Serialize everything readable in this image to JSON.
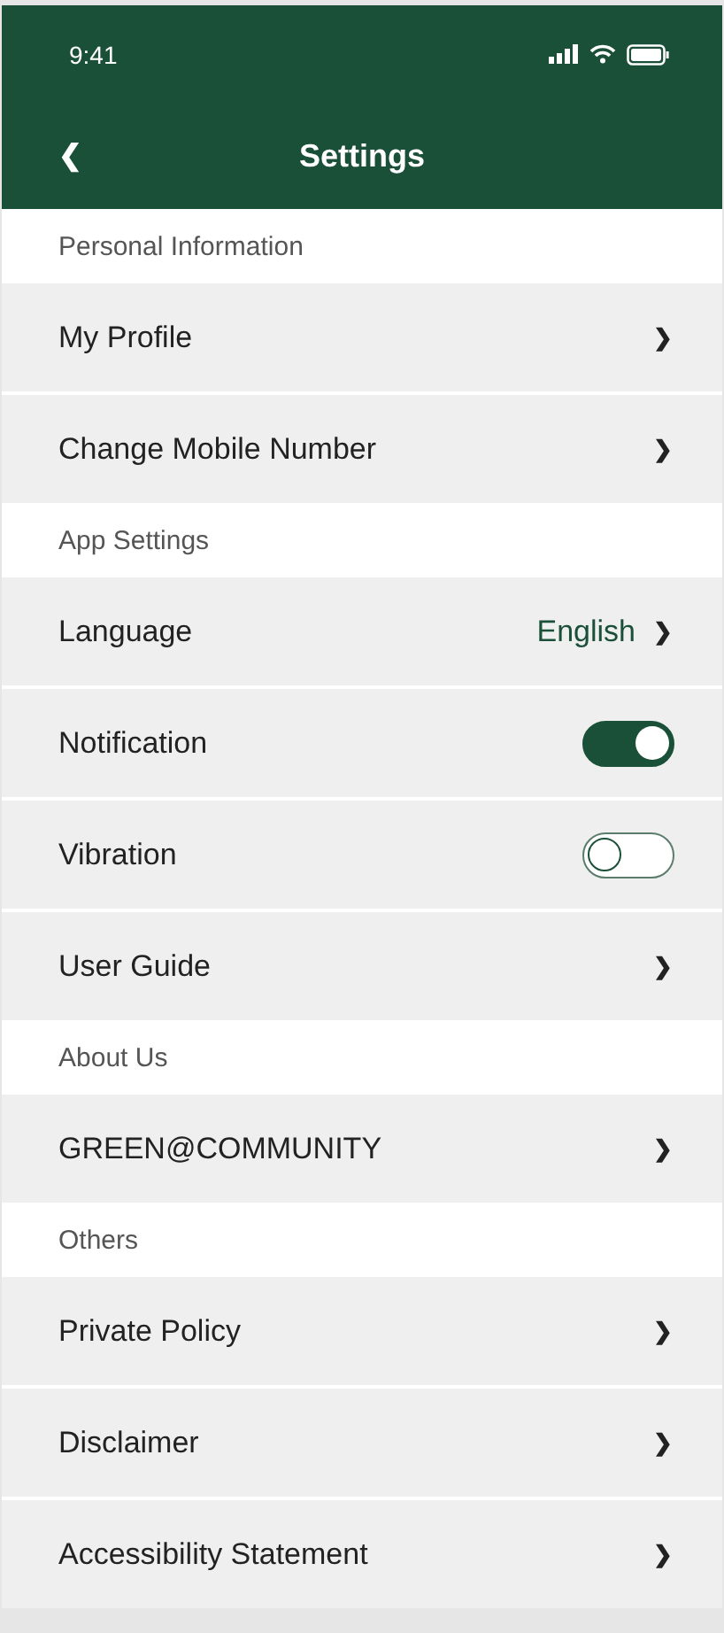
{
  "status_bar": {
    "time": "9:41"
  },
  "header": {
    "back": "❮",
    "title": "Settings"
  },
  "sections": [
    {
      "title": "Personal Information",
      "items": [
        {
          "kind": "link",
          "label": "My Profile",
          "chevron": "❯"
        },
        {
          "kind": "link",
          "label": "Change Mobile Number",
          "chevron": "❯"
        }
      ]
    },
    {
      "title": "App Settings",
      "items": [
        {
          "kind": "link",
          "label": "Language",
          "value": "English",
          "chevron": "❯"
        },
        {
          "kind": "toggle",
          "label": "Notification",
          "on": true
        },
        {
          "kind": "toggle",
          "label": "Vibration",
          "on": false
        },
        {
          "kind": "link",
          "label": "User Guide",
          "chevron": "❯"
        }
      ]
    },
    {
      "title": "About Us",
      "items": [
        {
          "kind": "link",
          "label": "GREEN@COMMUNITY",
          "chevron": "❯"
        }
      ]
    },
    {
      "title": "Others",
      "items": [
        {
          "kind": "link",
          "label": "Private Policy",
          "chevron": "❯"
        },
        {
          "kind": "link",
          "label": "Disclaimer",
          "chevron": "❯"
        },
        {
          "kind": "link",
          "label": "Accessibility Statement",
          "chevron": "❯"
        }
      ]
    }
  ]
}
